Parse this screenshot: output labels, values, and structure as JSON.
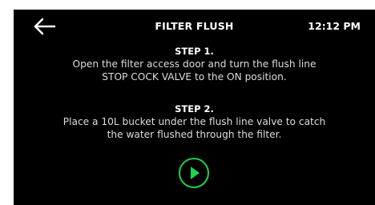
{
  "header": {
    "title": "FILTER FLUSH",
    "time": "12:12 PM",
    "back_icon": "arrow-left-icon"
  },
  "steps": [
    {
      "heading": "STEP 1.",
      "lines": [
        "Open the filter access door and turn the flush line",
        "STOP COCK VALVE to the ON position."
      ]
    },
    {
      "heading": "STEP 2.",
      "lines": [
        "Place a 10L bucket under the flush line valve to catch",
        "the water flushed through the filter."
      ]
    }
  ],
  "controls": {
    "play_icon": "play-icon"
  },
  "colors": {
    "background": "#000000",
    "text": "#ffffff",
    "accent": "#1fd14b"
  }
}
